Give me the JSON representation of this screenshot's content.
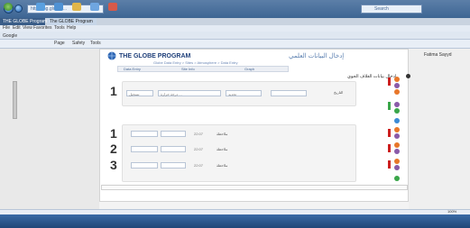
{
  "browser": {
    "address": "http://thg.globep...",
    "search_placeholder": "Search",
    "tabs": [
      "THE GLOBE Program ...",
      "The GLOBE Program"
    ],
    "menu": [
      "File",
      "Edit",
      "View",
      "Favorites",
      "Tools",
      "Help"
    ],
    "command_bar": [
      "Page",
      "Safety",
      "Tools"
    ],
    "favorites": [
      "Google"
    ],
    "right_label": "Fatima Sayyd",
    "zoom": "100%"
  },
  "site": {
    "brand": "THE GLOBE PROGRAM",
    "arabic_title": "إدخال البيانات العلمي",
    "breadcrumb": "Globe Data Entry > Sites > Atmosphere > Data Entry",
    "subtabs": [
      "Data Entry",
      "Site Info",
      "Graph"
    ],
    "section_title": "إدخال بيانات الغلاف الجوي"
  },
  "rows_top": [
    {
      "num": "1",
      "label": "التاريخ",
      "field1": "تحديد",
      "field2": "درجة حرارة ...",
      "field3": "تسجيل"
    }
  ],
  "rows_bottom": [
    {
      "num": "1",
      "time": "22:07",
      "label": "ملاحظة"
    },
    {
      "num": "2",
      "time": "22:07",
      "label": "ملاحظة"
    },
    {
      "num": "3",
      "time": "22:07",
      "label": "ملاحظة"
    }
  ],
  "colors": {
    "accent": "#1e3f7a",
    "orange": "#e8772a",
    "green": "#3aa64a",
    "purple": "#8a5aa8",
    "red": "#cc1f1f"
  }
}
